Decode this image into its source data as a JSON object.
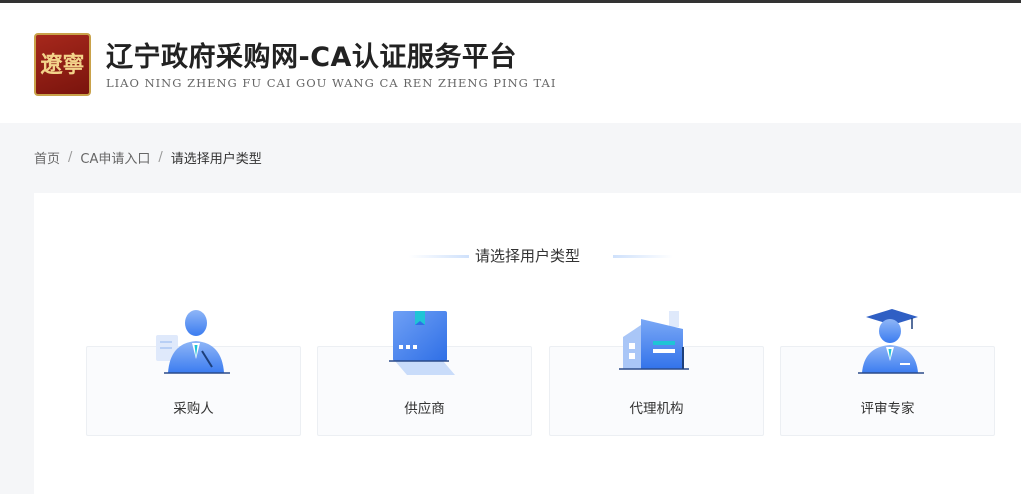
{
  "header": {
    "logo_text": "遼寧",
    "title": "辽宁政府采购网-CA认证服务平台",
    "subtitle": "LIAO NING ZHENG FU CAI GOU WANG  CA REN ZHENG PING TAI"
  },
  "breadcrumb": {
    "home": "首页",
    "separator": "/",
    "ca_entry": "CA申请入口",
    "current": "请选择用户类型"
  },
  "main": {
    "section_title": "请选择用户类型",
    "user_types": [
      {
        "label": "采购人",
        "icon": "purchaser-icon"
      },
      {
        "label": "供应商",
        "icon": "supplier-icon"
      },
      {
        "label": "代理机构",
        "icon": "agency-icon"
      },
      {
        "label": "评审专家",
        "icon": "expert-icon"
      }
    ]
  },
  "colors": {
    "accent_blue": "#3b7cf0",
    "logo_red": "#8e1d14",
    "page_bg": "#f5f6f8"
  }
}
